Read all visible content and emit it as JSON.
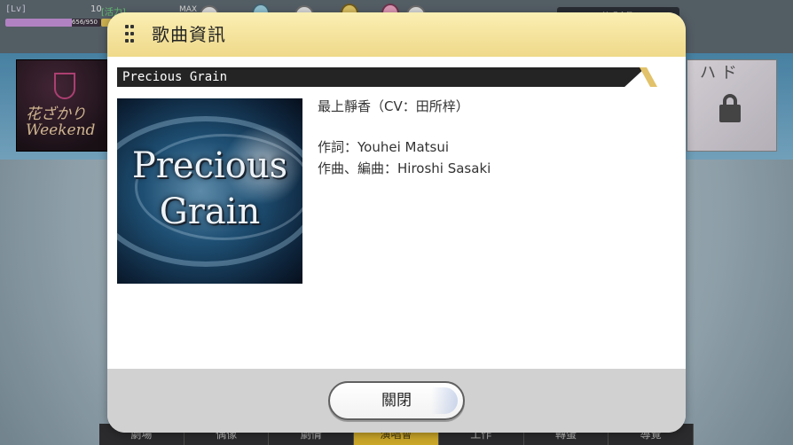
{
  "hud": {
    "level_tag": "[Lv]",
    "level_value": "10",
    "exp_text": "656/950",
    "exp_fraction": 0.69,
    "stamina_tag": "[活力]",
    "stamina_max": "MAX",
    "stamina_fraction": 1.0,
    "top_right_label": "演唱會準"
  },
  "background": {
    "left_banner_text": "花ざかり Weekend",
    "right_banner_kana": "ハ ド",
    "bottom_nav": [
      "劇場",
      "偶像",
      "劇情",
      "演唱會",
      "工作",
      "轉蛋",
      "導覽"
    ],
    "active_nav_index": 3
  },
  "dialog": {
    "title": "歌曲資訊",
    "song_title": "Precious Grain",
    "jacket_text_line1": "Precious",
    "jacket_text_line2": "Grain",
    "singer": "最上靜香（CV：田所梓）",
    "lyrics": "作詞：Youhei Matsui",
    "composition": "作曲、編曲：Hiroshi Sasaki",
    "close_label": "關閉"
  },
  "colors": {
    "header_gold": "#efd98a",
    "footer_gray": "#d1d1d1",
    "song_bar": "#242424",
    "accent_gold": "#e2c26a"
  }
}
